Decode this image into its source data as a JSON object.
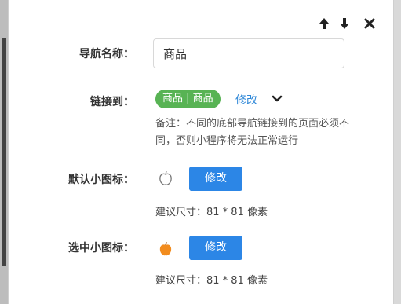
{
  "form": {
    "nav_name": {
      "label": "导航名称：",
      "value": "商品"
    },
    "link_to": {
      "label": "链接到：",
      "badge": "商品 | 商品",
      "modify": "修改",
      "note": "备注：不同的底部导航链接到的页面必须不同，否则小程序将无法正常运行"
    },
    "default_icon": {
      "label": "默认小图标：",
      "button": "修改",
      "hint": "建议尺寸：81 * 81 像素"
    },
    "selected_icon": {
      "label": "选中小图标：",
      "button": "修改",
      "hint": "建议尺寸：81 * 81 像素"
    }
  },
  "colors": {
    "accent": "#2c86e6",
    "badge": "#58b354",
    "link": "#2f88d8",
    "selected_icon": "#f28c1e"
  },
  "icons": {
    "move_up": "arrow-up-icon",
    "move_down": "arrow-down-icon",
    "close": "close-icon",
    "dropdown": "chevron-down-icon"
  }
}
